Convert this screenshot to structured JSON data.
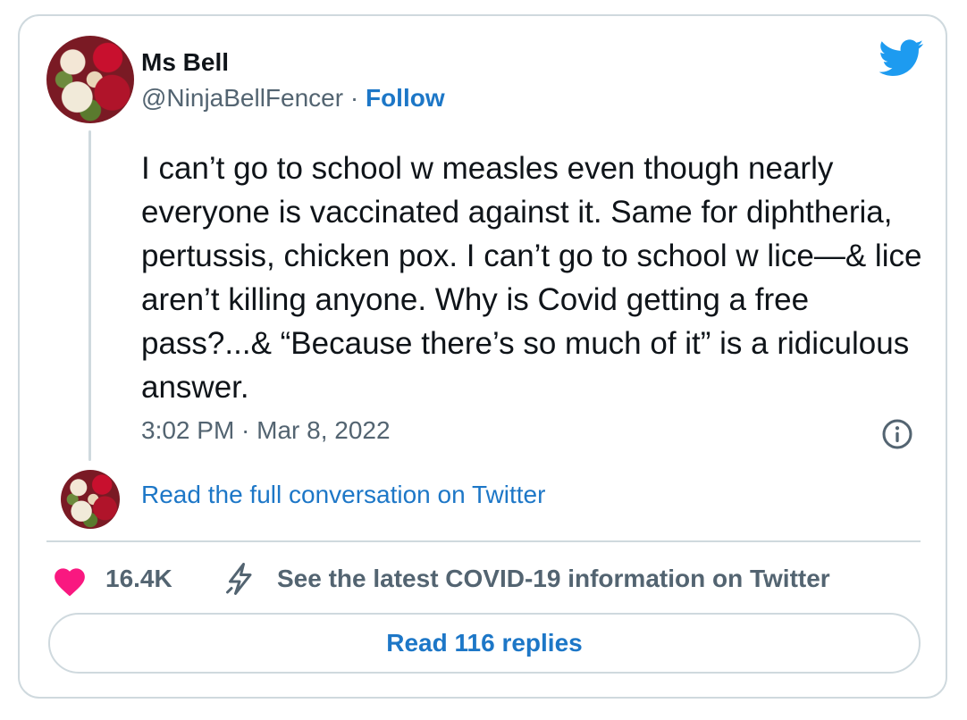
{
  "author": {
    "name": "Ms Bell",
    "handle": "@NinjaBellFencer",
    "separator": "·",
    "follow_label": "Follow"
  },
  "tweet": {
    "text": "I can’t go to school w measles even though nearly everyone is vaccinated against it. Same for diphtheria, pertussis, chicken pox. I can’t go to school w lice—& lice aren’t killing anyone. Why is Covid getting a free pass?...& “Because there’s so much of it” is a ridiculous answer.",
    "timestamp": "3:02 PM · Mar 8, 2022"
  },
  "conversation_link": "Read the full conversation on Twitter",
  "actions": {
    "likes": "16.4K",
    "covid_info": "See the latest COVID-19 information on Twitter",
    "replies_button": "Read 116 replies"
  },
  "icons": {
    "brand": "twitter-bird-icon",
    "info": "info-icon",
    "like": "heart-icon",
    "covid": "lightning-bolt-icon"
  },
  "colors": {
    "link": "#1d77c7",
    "brand": "#1d9bf0",
    "heart": "#f91880",
    "muted": "#536471",
    "border": "#cfd9de"
  }
}
